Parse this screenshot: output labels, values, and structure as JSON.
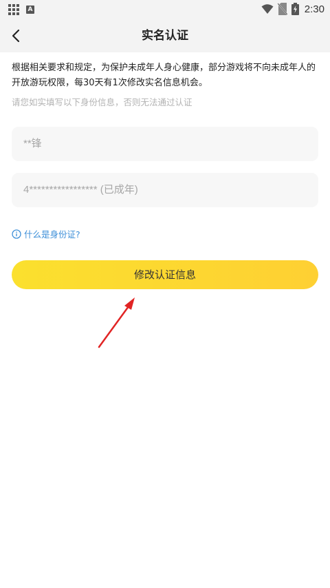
{
  "status_bar": {
    "time": "2:30",
    "left_icons": [
      "apps-grid-icon",
      "a-notification-icon"
    ],
    "right_icons": [
      "wifi-icon",
      "no-sim-icon",
      "battery-icon"
    ]
  },
  "header": {
    "title": "实名认证",
    "back_icon": "chevron-left-icon"
  },
  "notice": {
    "text": "根据相关要求和规定，为保护未成年人身心健康，部分游戏将不向未成年人的开放游玩权限，每30天有1次修改实名信息机会。",
    "hint": "请您如实填写以下身份信息，否则无法通过认证"
  },
  "form": {
    "name_value": "**锋",
    "id_value": "4***************** (已成年)"
  },
  "help_link": {
    "label": "什么是身份证?",
    "icon": "info-icon"
  },
  "submit": {
    "label": "修改认证信息"
  },
  "colors": {
    "accent_start": "#fbe02e",
    "accent_end": "#fed033",
    "link": "#3d8fd8",
    "annotation_arrow": "#e12424"
  }
}
